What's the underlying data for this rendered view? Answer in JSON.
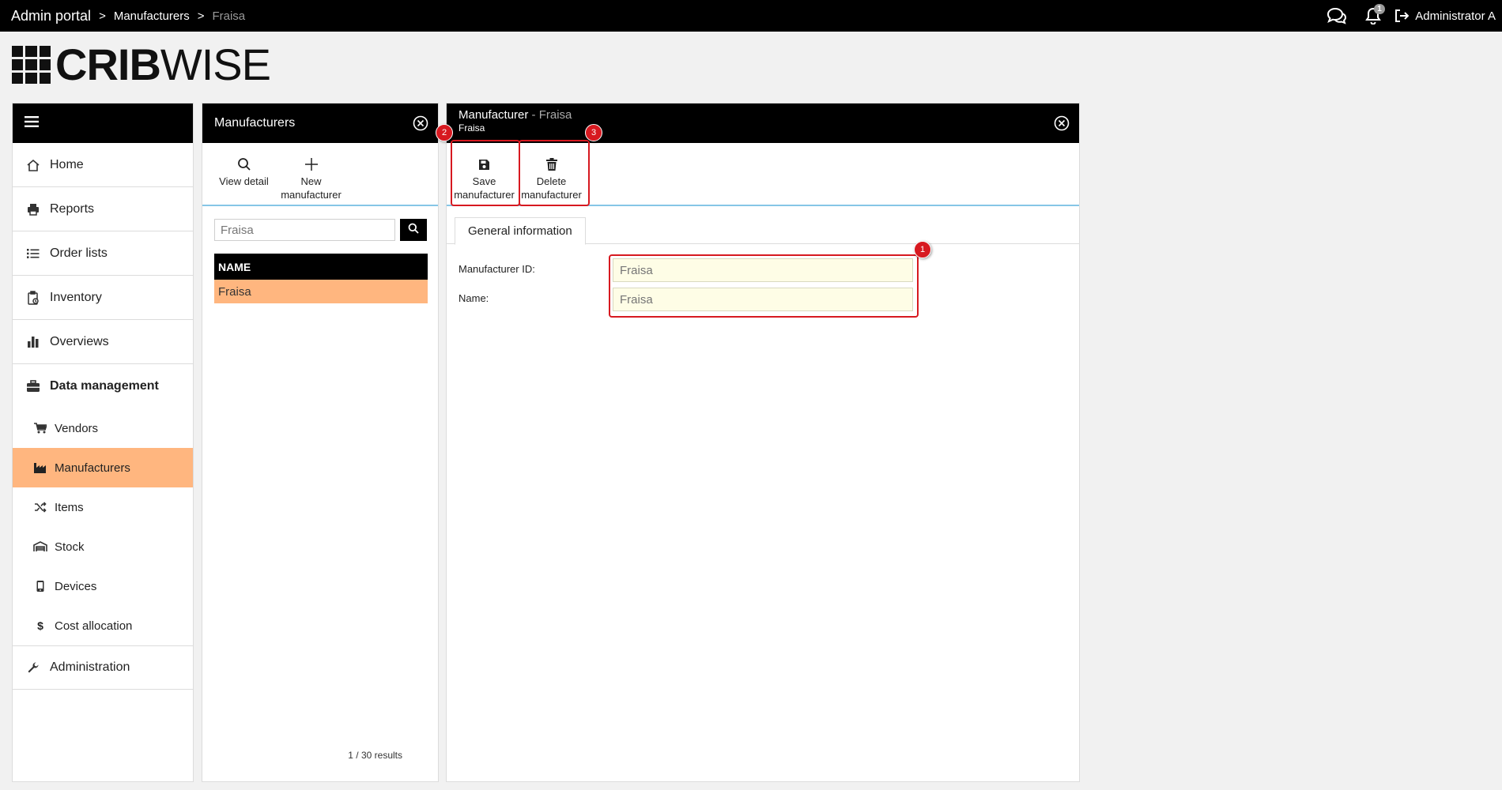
{
  "topbar": {
    "breadcrumb_root": "Admin portal",
    "breadcrumb_sep": ">",
    "breadcrumb_mid": "Manufacturers",
    "breadcrumb_current": "Fraisa",
    "notification_count": "1",
    "user_name": "Administrator A"
  },
  "logo": {
    "crib": "CRIB",
    "wise": "WISE"
  },
  "sidebar": {
    "items": [
      {
        "label": "Home",
        "icon": "home-icon"
      },
      {
        "label": "Reports",
        "icon": "printer-icon"
      },
      {
        "label": "Order lists",
        "icon": "list-icon"
      },
      {
        "label": "Inventory",
        "icon": "clipboard-icon"
      },
      {
        "label": "Overviews",
        "icon": "bar-chart-icon"
      }
    ],
    "section": {
      "label": "Data management",
      "icon": "briefcase-icon"
    },
    "subitems": [
      {
        "label": "Vendors",
        "icon": "cart-icon"
      },
      {
        "label": "Manufacturers",
        "icon": "factory-icon",
        "active": true
      },
      {
        "label": "Items",
        "icon": "shuffle-icon"
      },
      {
        "label": "Stock",
        "icon": "warehouse-icon"
      },
      {
        "label": "Devices",
        "icon": "mobile-icon"
      },
      {
        "label": "Cost allocation",
        "icon": "dollar-icon"
      }
    ],
    "admin": {
      "label": "Administration",
      "icon": "wrench-icon"
    }
  },
  "list_panel": {
    "title": "Manufacturers",
    "tools": {
      "view_detail": "View detail",
      "new_line1": "New",
      "new_line2": "manufacturer"
    },
    "search_placeholder": "Fraisa",
    "column_header": "NAME",
    "rows": [
      "Fraisa"
    ],
    "results": "1 / 30 results"
  },
  "detail_panel": {
    "title_prefix": "Manufacturer",
    "title_sep": " - ",
    "title_name": "Fraisa",
    "subtitle": "Fraisa",
    "tools": {
      "save_line1": "Save",
      "save_line2": "manufacturer",
      "delete_line1": "Delete",
      "delete_line2": "manufacturer"
    },
    "tab": "General information",
    "fields": {
      "manufacturer_id_label": "Manufacturer ID:",
      "manufacturer_id_placeholder": "Fraisa",
      "name_label": "Name:",
      "name_placeholder": "Fraisa"
    },
    "markers": [
      "1",
      "2",
      "3"
    ]
  },
  "colors": {
    "accent_active": "#ffb67f",
    "highlight": "#d71920",
    "toolbar_line": "#86c6e6",
    "input_bg": "#fefde6"
  }
}
